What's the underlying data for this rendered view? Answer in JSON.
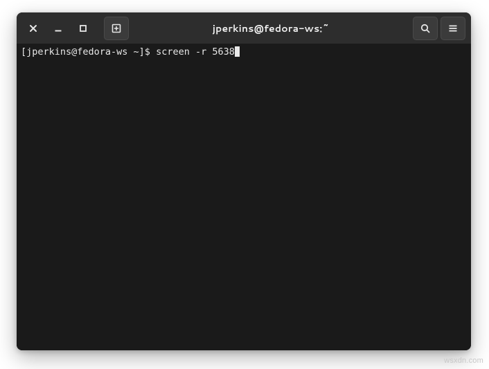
{
  "window": {
    "title": "jperkins@fedora-ws:~"
  },
  "titlebar": {
    "close_label": "Close",
    "minimize_label": "Minimize",
    "maximize_label": "Maximize",
    "new_tab_label": "New Tab",
    "search_label": "Search",
    "menu_label": "Menu"
  },
  "terminal": {
    "prompt": "[jperkins@fedora-ws ~]$ ",
    "command": "screen -r 5638",
    "user": "jperkins",
    "host": "fedora-ws",
    "cwd": "~"
  },
  "watermark": "wsxdn.com"
}
